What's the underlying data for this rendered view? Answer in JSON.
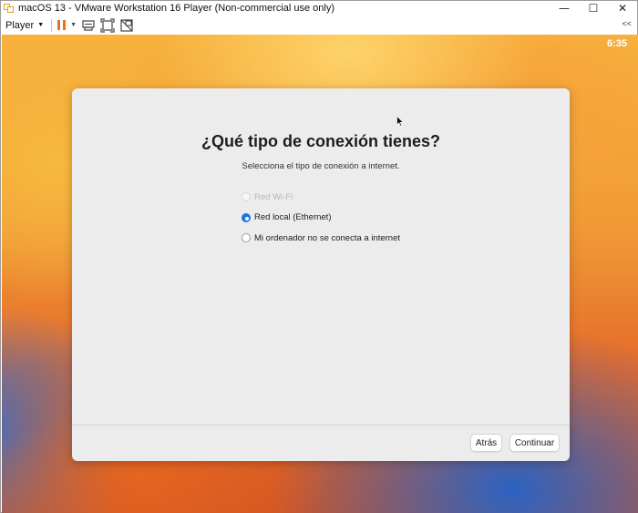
{
  "window": {
    "title": "macOS 13 - VMware Workstation 16 Player (Non-commercial use only)",
    "controls": {
      "minimize": "—",
      "maximize": "☐",
      "close": "✕"
    }
  },
  "toolbar": {
    "player_menu": "Player",
    "icons": [
      "pause-icon",
      "send-ctrl-alt-del-icon",
      "fit-guest-icon",
      "unity-icon"
    ],
    "collapse": "<<"
  },
  "guest": {
    "clock": "6:35",
    "dialog": {
      "title": "¿Qué tipo de conexión tienes?",
      "subtitle": "Selecciona el tipo de conexión a internet.",
      "options": [
        {
          "label": "Red Wi-Fi",
          "state": "disabled"
        },
        {
          "label": "Red local (Ethernet)",
          "state": "selected"
        },
        {
          "label": "Mi ordenador no se conecta a internet",
          "state": "unselected"
        }
      ],
      "buttons": {
        "back": "Atrás",
        "continue": "Continuar"
      }
    }
  },
  "colors": {
    "accent": "#1a72e8",
    "pause": "#e8731c",
    "app_icon": "#e4a11b"
  }
}
